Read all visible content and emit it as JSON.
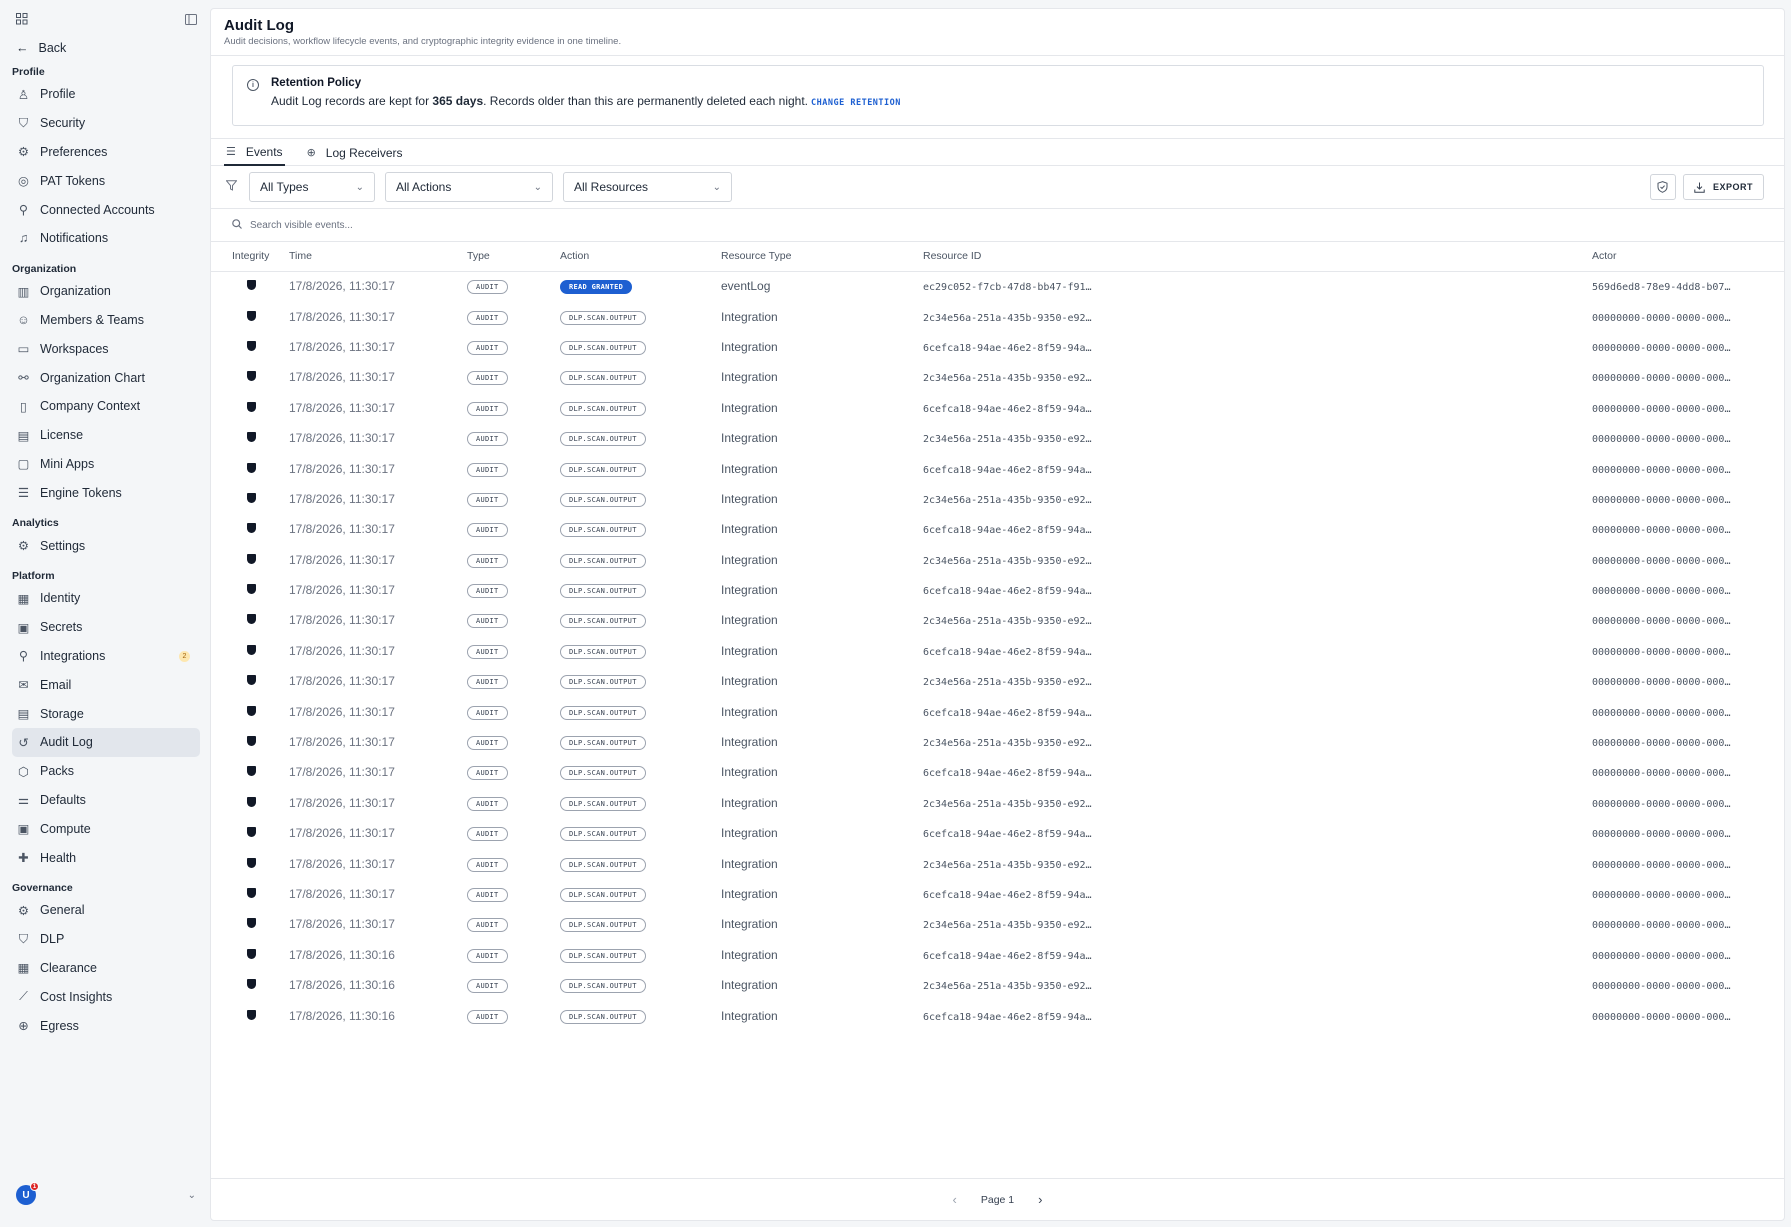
{
  "sidebar": {
    "back_label": "Back",
    "sections": [
      {
        "title": "Profile",
        "items": [
          {
            "label": "Profile",
            "icon": "user-icon",
            "glyph": "♙"
          },
          {
            "label": "Security",
            "icon": "shield-icon",
            "glyph": "⛉"
          },
          {
            "label": "Preferences",
            "icon": "gear-icon",
            "glyph": "⚙"
          },
          {
            "label": "PAT Tokens",
            "icon": "token-icon",
            "glyph": "◎"
          },
          {
            "label": "Connected Accounts",
            "icon": "plug-icon",
            "glyph": "⚲"
          },
          {
            "label": "Notifications",
            "icon": "bell-icon",
            "glyph": "♫"
          }
        ]
      },
      {
        "title": "Organization",
        "items": [
          {
            "label": "Organization",
            "icon": "building-icon",
            "glyph": "▥"
          },
          {
            "label": "Members & Teams",
            "icon": "users-icon",
            "glyph": "☺"
          },
          {
            "label": "Workspaces",
            "icon": "monitor-icon",
            "glyph": "▭"
          },
          {
            "label": "Organization Chart",
            "icon": "network-icon",
            "glyph": "⚯"
          },
          {
            "label": "Company Context",
            "icon": "book-icon",
            "glyph": "▯"
          },
          {
            "label": "License",
            "icon": "card-icon",
            "glyph": "▤"
          },
          {
            "label": "Mini Apps",
            "icon": "window-icon",
            "glyph": "▢"
          },
          {
            "label": "Engine Tokens",
            "icon": "database-icon",
            "glyph": "☰"
          }
        ]
      },
      {
        "title": "Analytics",
        "items": [
          {
            "label": "Settings",
            "icon": "gear-icon",
            "glyph": "⚙"
          }
        ]
      },
      {
        "title": "Platform",
        "items": [
          {
            "label": "Identity",
            "icon": "id-icon",
            "glyph": "▦"
          },
          {
            "label": "Secrets",
            "icon": "lock-icon",
            "glyph": "▣"
          },
          {
            "label": "Integrations",
            "icon": "plug-icon",
            "glyph": "⚲",
            "badge": "2"
          },
          {
            "label": "Email",
            "icon": "mail-icon",
            "glyph": "✉"
          },
          {
            "label": "Storage",
            "icon": "storage-icon",
            "glyph": "▤"
          },
          {
            "label": "Audit Log",
            "icon": "history-icon",
            "glyph": "↺",
            "active": true
          },
          {
            "label": "Packs",
            "icon": "package-icon",
            "glyph": "⬡"
          },
          {
            "label": "Defaults",
            "icon": "sliders-icon",
            "glyph": "⚌"
          },
          {
            "label": "Compute",
            "icon": "cpu-icon",
            "glyph": "▣"
          },
          {
            "label": "Health",
            "icon": "health-icon",
            "glyph": "✚"
          }
        ]
      },
      {
        "title": "Governance",
        "items": [
          {
            "label": "General",
            "icon": "gear-icon",
            "glyph": "⚙"
          },
          {
            "label": "DLP",
            "icon": "shield-icon",
            "glyph": "⛉"
          },
          {
            "label": "Clearance",
            "icon": "badge-icon",
            "glyph": "▦"
          },
          {
            "label": "Cost Insights",
            "icon": "chart-icon",
            "glyph": "⟋"
          },
          {
            "label": "Egress",
            "icon": "globe-icon",
            "glyph": "⊕"
          }
        ]
      }
    ],
    "avatar_initial": "U",
    "avatar_badge": "1"
  },
  "header": {
    "title": "Audit Log",
    "subtitle": "Audit decisions, workflow lifecycle events, and cryptographic integrity evidence in one timeline."
  },
  "banner": {
    "title": "Retention Policy",
    "text_before": "Audit Log records are kept for ",
    "days": "365 days",
    "text_after": ". Records older than this are permanently deleted each night.",
    "link": "CHANGE RETENTION"
  },
  "tabs": [
    {
      "label": "Events",
      "icon": "list-icon",
      "active": true
    },
    {
      "label": "Log Receivers",
      "icon": "globe-icon",
      "active": false
    }
  ],
  "filters": {
    "types": "All Types",
    "actions": "All Actions",
    "resources": "All Resources",
    "export_label": "EXPORT"
  },
  "search": {
    "placeholder": "Search visible events..."
  },
  "columns": {
    "integrity": "Integrity",
    "time": "Time",
    "type": "Type",
    "action": "Action",
    "resource_type": "Resource Type",
    "resource_id": "Resource ID",
    "actor": "Actor"
  },
  "rows": [
    {
      "time": "17/8/2026, 11:30:17",
      "type": "AUDIT",
      "action": "READ GRANTED",
      "granted": true,
      "resource_type": "eventLog",
      "resource_id": "ec29c052-f7cb-47d8-bb47-f91…",
      "actor": "569d6ed8-78e9-4dd8-b07…"
    },
    {
      "time": "17/8/2026, 11:30:17",
      "type": "AUDIT",
      "action": "DLP.SCAN.OUTPUT",
      "resource_type": "Integration",
      "resource_id": "2c34e56a-251a-435b-9350-e92…",
      "actor": "00000000-0000-0000-000…"
    },
    {
      "time": "17/8/2026, 11:30:17",
      "type": "AUDIT",
      "action": "DLP.SCAN.OUTPUT",
      "resource_type": "Integration",
      "resource_id": "6cefca18-94ae-46e2-8f59-94a…",
      "actor": "00000000-0000-0000-000…"
    },
    {
      "time": "17/8/2026, 11:30:17",
      "type": "AUDIT",
      "action": "DLP.SCAN.OUTPUT",
      "resource_type": "Integration",
      "resource_id": "2c34e56a-251a-435b-9350-e92…",
      "actor": "00000000-0000-0000-000…"
    },
    {
      "time": "17/8/2026, 11:30:17",
      "type": "AUDIT",
      "action": "DLP.SCAN.OUTPUT",
      "resource_type": "Integration",
      "resource_id": "6cefca18-94ae-46e2-8f59-94a…",
      "actor": "00000000-0000-0000-000…"
    },
    {
      "time": "17/8/2026, 11:30:17",
      "type": "AUDIT",
      "action": "DLP.SCAN.OUTPUT",
      "resource_type": "Integration",
      "resource_id": "2c34e56a-251a-435b-9350-e92…",
      "actor": "00000000-0000-0000-000…"
    },
    {
      "time": "17/8/2026, 11:30:17",
      "type": "AUDIT",
      "action": "DLP.SCAN.OUTPUT",
      "resource_type": "Integration",
      "resource_id": "6cefca18-94ae-46e2-8f59-94a…",
      "actor": "00000000-0000-0000-000…"
    },
    {
      "time": "17/8/2026, 11:30:17",
      "type": "AUDIT",
      "action": "DLP.SCAN.OUTPUT",
      "resource_type": "Integration",
      "resource_id": "2c34e56a-251a-435b-9350-e92…",
      "actor": "00000000-0000-0000-000…"
    },
    {
      "time": "17/8/2026, 11:30:17",
      "type": "AUDIT",
      "action": "DLP.SCAN.OUTPUT",
      "resource_type": "Integration",
      "resource_id": "6cefca18-94ae-46e2-8f59-94a…",
      "actor": "00000000-0000-0000-000…"
    },
    {
      "time": "17/8/2026, 11:30:17",
      "type": "AUDIT",
      "action": "DLP.SCAN.OUTPUT",
      "resource_type": "Integration",
      "resource_id": "2c34e56a-251a-435b-9350-e92…",
      "actor": "00000000-0000-0000-000…"
    },
    {
      "time": "17/8/2026, 11:30:17",
      "type": "AUDIT",
      "action": "DLP.SCAN.OUTPUT",
      "resource_type": "Integration",
      "resource_id": "6cefca18-94ae-46e2-8f59-94a…",
      "actor": "00000000-0000-0000-000…"
    },
    {
      "time": "17/8/2026, 11:30:17",
      "type": "AUDIT",
      "action": "DLP.SCAN.OUTPUT",
      "resource_type": "Integration",
      "resource_id": "2c34e56a-251a-435b-9350-e92…",
      "actor": "00000000-0000-0000-000…"
    },
    {
      "time": "17/8/2026, 11:30:17",
      "type": "AUDIT",
      "action": "DLP.SCAN.OUTPUT",
      "resource_type": "Integration",
      "resource_id": "6cefca18-94ae-46e2-8f59-94a…",
      "actor": "00000000-0000-0000-000…"
    },
    {
      "time": "17/8/2026, 11:30:17",
      "type": "AUDIT",
      "action": "DLP.SCAN.OUTPUT",
      "resource_type": "Integration",
      "resource_id": "2c34e56a-251a-435b-9350-e92…",
      "actor": "00000000-0000-0000-000…"
    },
    {
      "time": "17/8/2026, 11:30:17",
      "type": "AUDIT",
      "action": "DLP.SCAN.OUTPUT",
      "resource_type": "Integration",
      "resource_id": "6cefca18-94ae-46e2-8f59-94a…",
      "actor": "00000000-0000-0000-000…"
    },
    {
      "time": "17/8/2026, 11:30:17",
      "type": "AUDIT",
      "action": "DLP.SCAN.OUTPUT",
      "resource_type": "Integration",
      "resource_id": "2c34e56a-251a-435b-9350-e92…",
      "actor": "00000000-0000-0000-000…"
    },
    {
      "time": "17/8/2026, 11:30:17",
      "type": "AUDIT",
      "action": "DLP.SCAN.OUTPUT",
      "resource_type": "Integration",
      "resource_id": "6cefca18-94ae-46e2-8f59-94a…",
      "actor": "00000000-0000-0000-000…"
    },
    {
      "time": "17/8/2026, 11:30:17",
      "type": "AUDIT",
      "action": "DLP.SCAN.OUTPUT",
      "resource_type": "Integration",
      "resource_id": "2c34e56a-251a-435b-9350-e92…",
      "actor": "00000000-0000-0000-000…"
    },
    {
      "time": "17/8/2026, 11:30:17",
      "type": "AUDIT",
      "action": "DLP.SCAN.OUTPUT",
      "resource_type": "Integration",
      "resource_id": "6cefca18-94ae-46e2-8f59-94a…",
      "actor": "00000000-0000-0000-000…"
    },
    {
      "time": "17/8/2026, 11:30:17",
      "type": "AUDIT",
      "action": "DLP.SCAN.OUTPUT",
      "resource_type": "Integration",
      "resource_id": "2c34e56a-251a-435b-9350-e92…",
      "actor": "00000000-0000-0000-000…"
    },
    {
      "time": "17/8/2026, 11:30:17",
      "type": "AUDIT",
      "action": "DLP.SCAN.OUTPUT",
      "resource_type": "Integration",
      "resource_id": "6cefca18-94ae-46e2-8f59-94a…",
      "actor": "00000000-0000-0000-000…"
    },
    {
      "time": "17/8/2026, 11:30:17",
      "type": "AUDIT",
      "action": "DLP.SCAN.OUTPUT",
      "resource_type": "Integration",
      "resource_id": "2c34e56a-251a-435b-9350-e92…",
      "actor": "00000000-0000-0000-000…"
    },
    {
      "time": "17/8/2026, 11:30:16",
      "type": "AUDIT",
      "action": "DLP.SCAN.OUTPUT",
      "resource_type": "Integration",
      "resource_id": "6cefca18-94ae-46e2-8f59-94a…",
      "actor": "00000000-0000-0000-000…"
    },
    {
      "time": "17/8/2026, 11:30:16",
      "type": "AUDIT",
      "action": "DLP.SCAN.OUTPUT",
      "resource_type": "Integration",
      "resource_id": "2c34e56a-251a-435b-9350-e92…",
      "actor": "00000000-0000-0000-000…"
    },
    {
      "time": "17/8/2026, 11:30:16",
      "type": "AUDIT",
      "action": "DLP.SCAN.OUTPUT",
      "resource_type": "Integration",
      "resource_id": "6cefca18-94ae-46e2-8f59-94a…",
      "actor": "00000000-0000-0000-000…"
    }
  ],
  "pager": {
    "label": "Page 1",
    "prev": "‹",
    "next": "›"
  },
  "colors": {
    "accent": "#1d5fd1",
    "active_nav": "#e2e6ec",
    "badge_bg": "#fde7b0"
  }
}
